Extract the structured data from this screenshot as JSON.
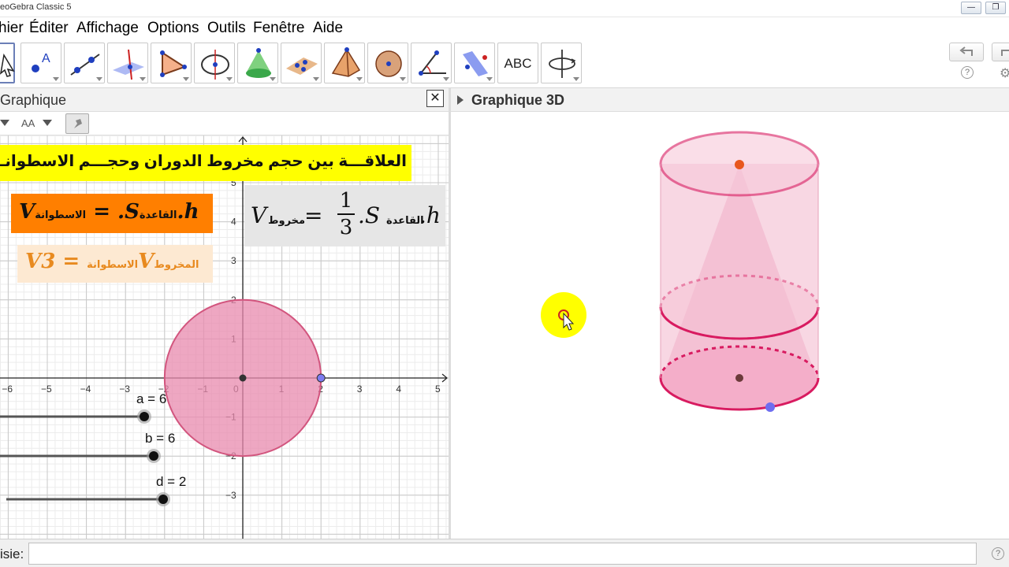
{
  "window": {
    "title": "eoGebra Classic 5"
  },
  "menu": [
    "hier",
    "Éditer",
    "Affichage",
    "Options",
    "Outils",
    "Fenêtre",
    "Aide"
  ],
  "toolbar": {
    "tools": [
      "move-tool",
      "point-tool",
      "line-tool",
      "perpendicular-line-tool",
      "polygon-tool",
      "circle-tool",
      "cone-tool",
      "plane-tool",
      "pyramid-tool",
      "sphere-tool",
      "angle-tool",
      "reflect-tool",
      "text-tool",
      "rotate-view-tool"
    ],
    "text_tool_label": "ABC"
  },
  "left_panel": {
    "title": "Graphique",
    "style_bar": {
      "font_label": "AA"
    }
  },
  "right_panel": {
    "title": "Graphique 3D"
  },
  "graphics2d": {
    "x_ticks": [
      "−6",
      "−5",
      "−4",
      "−3",
      "−2",
      "−1",
      "0",
      "1",
      "2",
      "3",
      "4",
      "5"
    ],
    "y_ticks": [
      "5",
      "4",
      "3",
      "2",
      "1",
      "−1",
      "−2",
      "−3"
    ],
    "circle_radius": 2,
    "circle_color": "#e88aae"
  },
  "texts": {
    "banner": "العلاقـــة بين حجم مخروط الدوران وحجـــم الاسطوانـــة",
    "formula_cylinder": {
      "v": "V",
      "sub": "الاسطوانة",
      "eq": " = .S",
      "sub2": "القاعدة",
      "tail": ".h"
    },
    "formula_ratio": {
      "v": "V",
      "sub": "الاسطوانة",
      "eq": " = 3V",
      "sub2": "المخروط"
    },
    "formula_cone": {
      "v": "V",
      "sub": "مخروط",
      "eq": " = ",
      "num": "1",
      "den": "3",
      "mid": ".S",
      "sub2": "القاعدة",
      "tail": ".h"
    }
  },
  "sliders": [
    {
      "label": "a = 6",
      "value": 6
    },
    {
      "label": "b = 6",
      "value": 6
    },
    {
      "label": "d = 2",
      "value": 2
    }
  ],
  "input_bar": {
    "label": "isie:",
    "value": ""
  },
  "colors": {
    "banner": "#ffff00",
    "formula_orange": "#ff7f00",
    "cylinder": "#e0336f",
    "highlight": "#ffff00"
  }
}
